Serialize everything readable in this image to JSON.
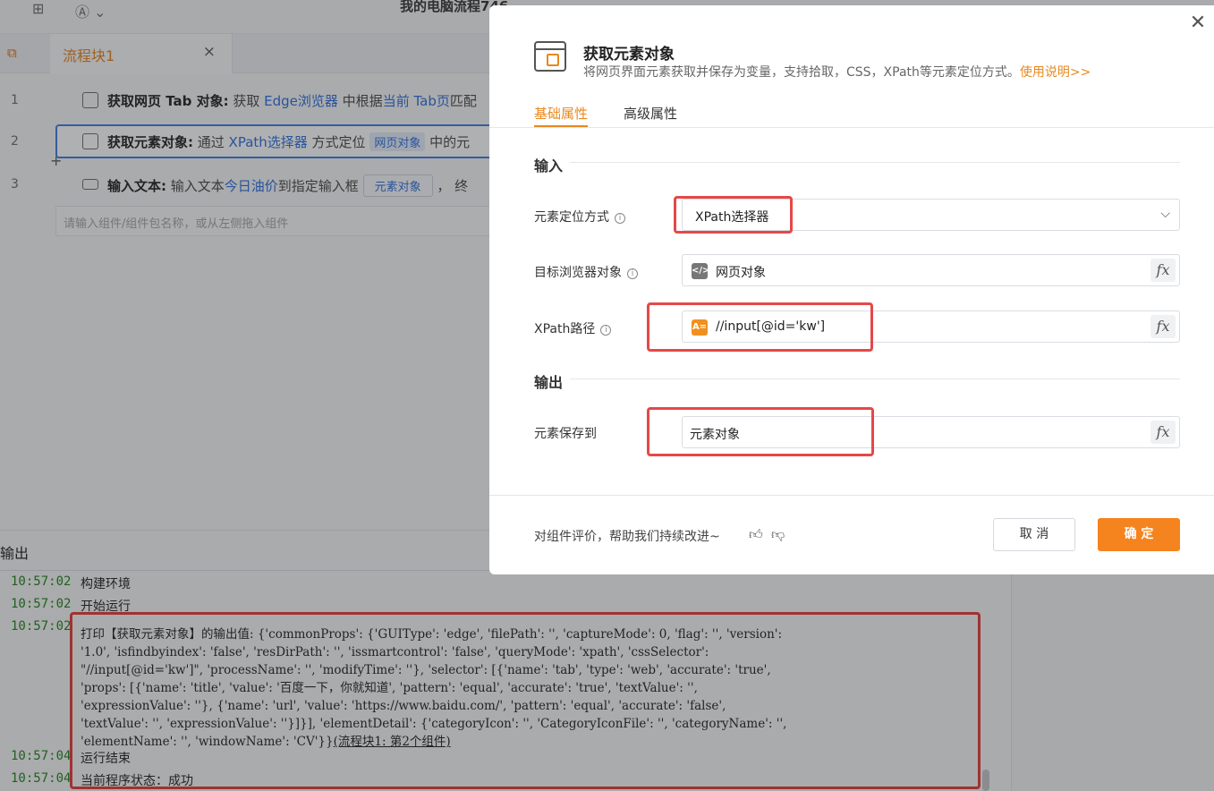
{
  "app": {
    "title": "我的电脑流程746"
  },
  "tabs": [
    {
      "label": "流程块1"
    }
  ],
  "flow": {
    "rows": [
      {
        "num": "1",
        "name": "获取网页 Tab 对象:",
        "p1": " 获取 ",
        "link1": "Edge浏览器",
        "p2": " 中根据",
        "link2": "当前 Tab页",
        "p3": "匹配"
      },
      {
        "num": "2",
        "name": "获取元素对象:",
        "p1": " 通过 ",
        "link1": "XPath选择器",
        "p2": " 方式定位 ",
        "chip": "网页对象",
        "p3": " 中的元"
      },
      {
        "num": "3",
        "name": "输入文本:",
        "p1": " 输入文本",
        "link1": "今日油价",
        "p2": "到指定输入框 ",
        "chip": "元素对象",
        "p3": " ，  终"
      }
    ],
    "component_search_placeholder": "请输入组件/组件包名称，或从左侧拖入组件"
  },
  "output": {
    "header": "输出",
    "logs": [
      {
        "ts": "10:57:02",
        "msg": "构建环境"
      },
      {
        "ts": "10:57:02",
        "msg": "开始运行"
      }
    ],
    "print_ts": "10:57:02",
    "print_lines": [
      "打印【获取元素对象】的输出值: {'commonProps': {'GUIType': 'edge', 'filePath': '', 'captureMode': 0, 'flag': '', 'version':",
      "'1.0', 'isfindbyindex': 'false', 'resDirPath': '', 'issmartcontrol': 'false', 'queryMode': 'xpath', 'cssSelector':",
      "\"//input[@id='kw']\", 'processName': '', 'modifyTime': ''}, 'selector': [{'name': 'tab', 'type': 'web', 'accurate': 'true',",
      "'props': [{'name': 'title', 'value': '百度一下，你就知道', 'pattern': 'equal', 'accurate': 'true', 'textValue': '',",
      "'expressionValue': ''}, {'name': 'url', 'value': 'https://www.baidu.com/', 'pattern': 'equal', 'accurate': 'false',",
      "'textValue': '', 'expressionValue': ''}]}], 'elementDetail': {'categoryIcon': '', 'CategoryIconFile': '', 'categoryName': '',",
      "'elementName': '', 'windowName': 'CV'}}"
    ],
    "print_link": "(流程块1: 第2个组件)",
    "end_logs": [
      {
        "ts": "10:57:04",
        "msg": "运行结束"
      },
      {
        "ts": "10:57:04",
        "msg": "当前程序状态：成功"
      }
    ]
  },
  "dialog": {
    "title": "获取元素对象",
    "description": "将网页界面元素获取并保存为变量，支持拾取，CSS，XPath等元素定位方式。",
    "help_link": "使用说明>>",
    "tab_basic": "基础属性",
    "tab_advanced": "高级属性",
    "section_input": "输入",
    "section_output": "输出",
    "fields": {
      "locate_label": "元素定位方式",
      "locate_value": "XPath选择器",
      "browser_label": "目标浏览器对象",
      "browser_value": "网页对象",
      "xpath_label": "XPath路径",
      "xpath_value": "//input[@id='kw']",
      "save_label": "元素保存到",
      "save_value": "元素对象"
    },
    "fx": "fx",
    "feedback": "对组件评价，帮助我们持续改进~",
    "cancel": "取 消",
    "ok": "确 定"
  },
  "colors": {
    "accent": "#f5841f",
    "link": "#3a78e0",
    "highlight": "#e54848",
    "timestamp": "#2e8b2e"
  }
}
